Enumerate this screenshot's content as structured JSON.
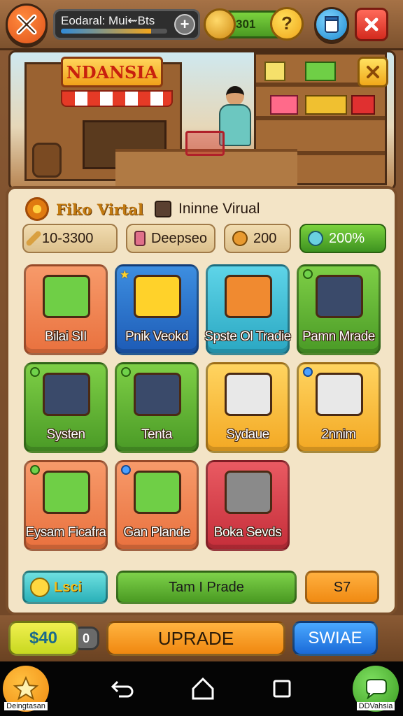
{
  "topbar": {
    "title": "Eodaral: Mui⇜Bts",
    "title_progress": 0.85,
    "coins": "301",
    "help_label": "?"
  },
  "scene": {
    "shop_sign": "NDANSIA"
  },
  "panel": {
    "title_primary": "Fiko Virtal",
    "title_secondary": "Ininne Virual",
    "stats": [
      {
        "value": "10-3300",
        "icon": "wrench-icon"
      },
      {
        "value": "Deepseo",
        "icon": "basket-icon"
      },
      {
        "value": "200",
        "icon": "bread-icon"
      },
      {
        "value": "200%",
        "icon": "key-icon"
      }
    ],
    "tiles": [
      {
        "label": "Bilai SII",
        "color": "orange",
        "icon": "green-box-icon",
        "badge": "none"
      },
      {
        "label": "Pnik Veokd",
        "color": "blue",
        "icon": "yellow-gift-box-icon",
        "badge": "star"
      },
      {
        "label": "Spste Ol Tradie",
        "color": "cyan",
        "icon": "orange-gift-icon",
        "badge": "none"
      },
      {
        "label": "Pamn Mrade",
        "color": "green",
        "icon": "tablet-icon",
        "badge": "dot"
      },
      {
        "label": "Systen",
        "color": "green",
        "icon": "soup-bowl-icon",
        "badge": "dot"
      },
      {
        "label": "Tenta",
        "color": "green",
        "icon": "shopping-cart-icon",
        "badge": "dot"
      },
      {
        "label": "Sydaue",
        "color": "yellow",
        "icon": "mug-icon",
        "badge": "none"
      },
      {
        "label": "2nnim",
        "color": "yellow",
        "icon": "red-box-icon",
        "badge": "dotb"
      },
      {
        "label": "Eysam Ficafra",
        "color": "orange",
        "icon": "cart-icon",
        "badge": "dot"
      },
      {
        "label": "Gan Plande",
        "color": "orange",
        "icon": "crate-icon",
        "badge": "dotb"
      },
      {
        "label": "Boka Sevds",
        "color": "red",
        "icon": "machine-icon",
        "badge": "none"
      }
    ],
    "bottom": {
      "left_label": "Lsci",
      "middle_label": "Tam I Prade",
      "right_label": "S7"
    }
  },
  "bottombar": {
    "cash": "$40",
    "count": "0",
    "upgrade_label": "UPRADE",
    "swap_label": "SWIAE"
  },
  "nav": {
    "left_caption": "Deingtasan",
    "right_caption": "DDVahsia"
  },
  "colors": {
    "wood": "#7d522e",
    "panel": "#f3e4c6",
    "green": "#4a9a26",
    "orange": "#e9713e"
  }
}
